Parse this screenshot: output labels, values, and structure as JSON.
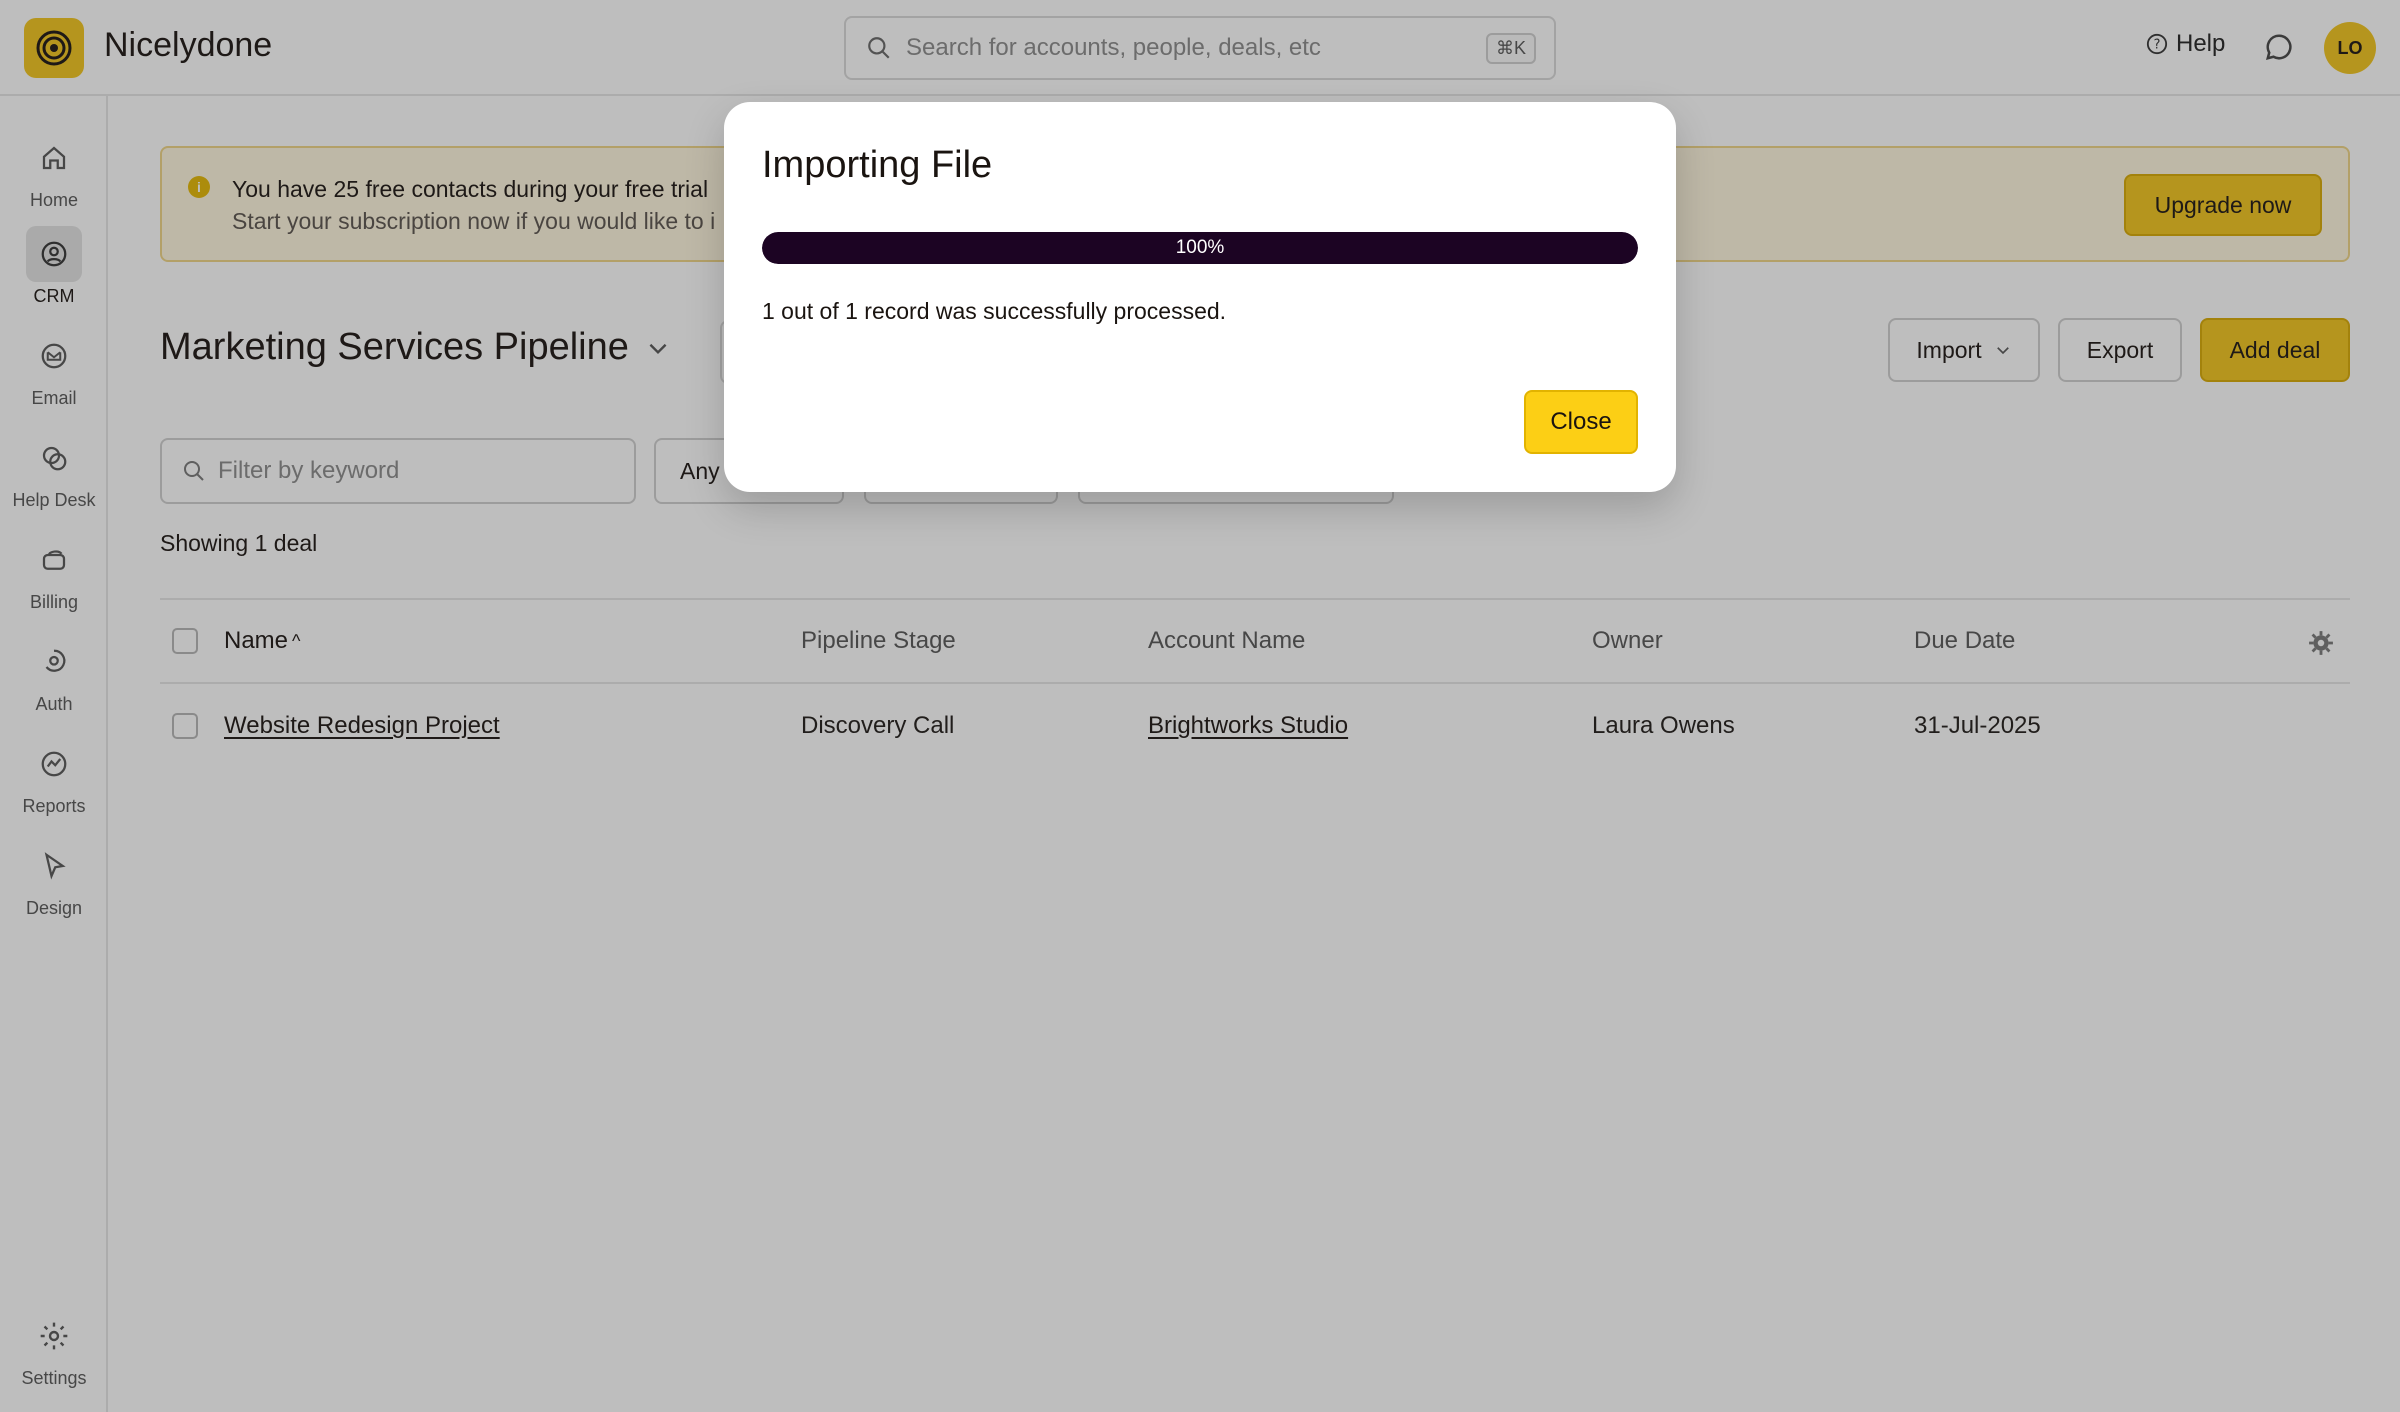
{
  "app": {
    "brand": "Nicelydone",
    "search_placeholder": "Search for accounts, people, deals, etc",
    "search_shortcut": "⌘K",
    "help_label": "Help",
    "avatar_initials": "LO"
  },
  "sidebar": {
    "items": [
      {
        "label": "Home",
        "icon": "home-icon"
      },
      {
        "label": "CRM",
        "icon": "crm-icon",
        "active": true
      },
      {
        "label": "Email",
        "icon": "email-icon"
      },
      {
        "label": "Help Desk",
        "icon": "help-desk-icon"
      },
      {
        "label": "Billing",
        "icon": "billing-icon"
      },
      {
        "label": "Auth",
        "icon": "auth-icon"
      },
      {
        "label": "Reports",
        "icon": "reports-icon"
      },
      {
        "label": "Design",
        "icon": "design-icon"
      }
    ],
    "settings_label": "Settings"
  },
  "banner": {
    "line1": "You have 25 free contacts during your free trial",
    "line2": "Start your subscription now if you would like to i",
    "upgrade_label": "Upgrade now"
  },
  "pipeline": {
    "title": "Marketing Services Pipeline",
    "import_label": "Import",
    "export_label": "Export",
    "add_label": "Add deal",
    "filter_placeholder": "Filter by keyword",
    "chip_any": "Any",
    "showing": "Showing 1 deal"
  },
  "table": {
    "columns": [
      "Name",
      "Pipeline Stage",
      "Account Name",
      "Owner",
      "Due Date"
    ],
    "sort_indicator": "^",
    "rows": [
      {
        "name": "Website Redesign Project",
        "stage": "Discovery Call",
        "account": "Brightworks Studio",
        "owner": "Laura Owens",
        "due": "31-Jul-2025"
      }
    ]
  },
  "modal": {
    "title": "Importing File",
    "progress_percent": 100,
    "progress_label": "100%",
    "message": "1 out of 1 record was successfully processed.",
    "close_label": "Close"
  },
  "colors": {
    "accent": "#f3c51a",
    "progress_fill": "#1c0423"
  }
}
